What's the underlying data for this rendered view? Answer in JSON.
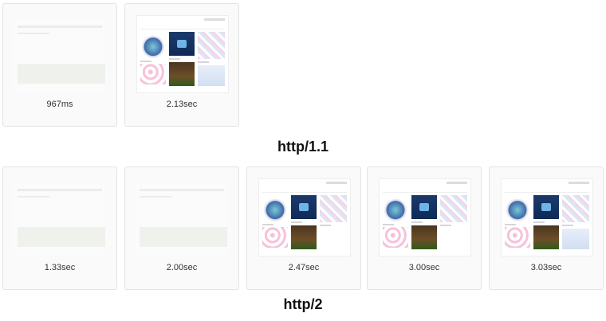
{
  "http1": {
    "label": "http/1.1",
    "frames": [
      {
        "time": "967ms",
        "state": "blank"
      },
      {
        "time": "2.13sec",
        "state": "loaded"
      }
    ]
  },
  "http2": {
    "label": "http/2",
    "frames": [
      {
        "time": "1.33sec",
        "state": "blank"
      },
      {
        "time": "2.00sec",
        "state": "blank"
      },
      {
        "time": "2.47sec",
        "state": "loaded"
      },
      {
        "time": "3.00sec",
        "state": "loaded"
      },
      {
        "time": "3.03sec",
        "state": "loaded"
      }
    ]
  }
}
